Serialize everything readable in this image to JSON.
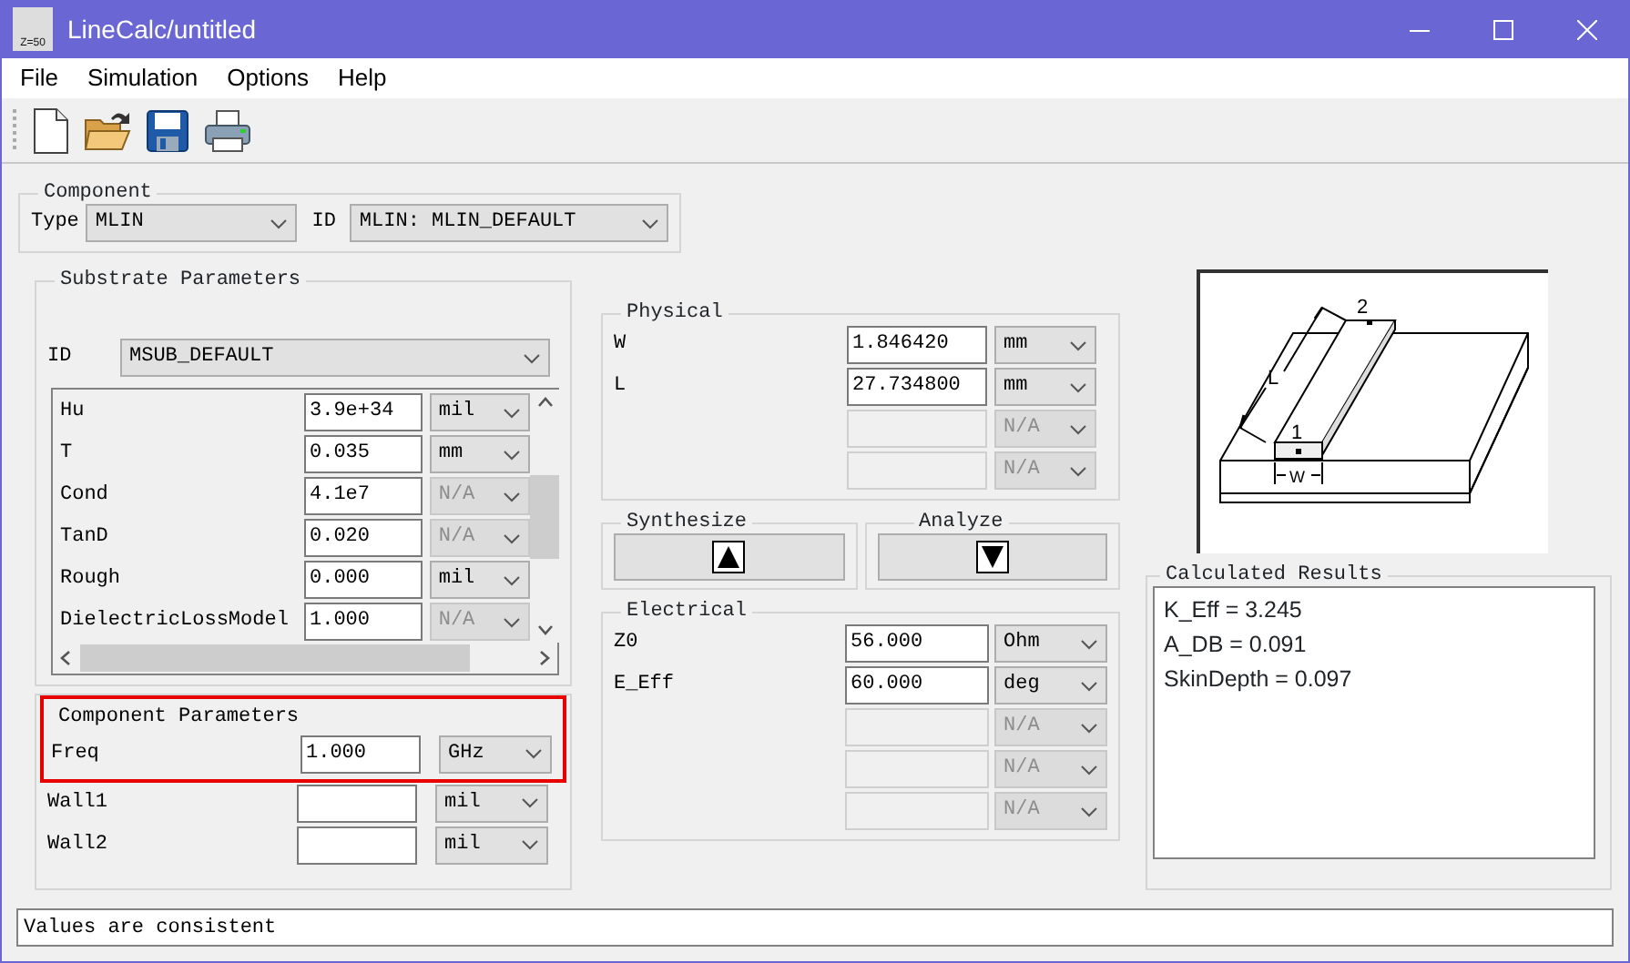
{
  "window": {
    "title": "LineCalc/untitled",
    "icon_label": "Z=50"
  },
  "menu": [
    "File",
    "Simulation",
    "Options",
    "Help"
  ],
  "component": {
    "title": "Component",
    "type_label": "Type",
    "type_value": "MLIN",
    "id_label": "ID",
    "id_value": "MLIN: MLIN_DEFAULT"
  },
  "substrate": {
    "title": "Substrate Parameters",
    "id_label": "ID",
    "id_value": "MSUB_DEFAULT",
    "params": [
      {
        "name": "Hu",
        "value": "3.9e+34",
        "unit": "mil",
        "unit_disabled": false
      },
      {
        "name": "T",
        "value": "0.035",
        "unit": "mm",
        "unit_disabled": false
      },
      {
        "name": "Cond",
        "value": "4.1e7",
        "unit": "N/A",
        "unit_disabled": true
      },
      {
        "name": "TanD",
        "value": "0.020",
        "unit": "N/A",
        "unit_disabled": true
      },
      {
        "name": "Rough",
        "value": "0.000",
        "unit": "mil",
        "unit_disabled": false
      },
      {
        "name": "DielectricLossModel",
        "value": "1.000",
        "unit": "N/A",
        "unit_disabled": true
      }
    ]
  },
  "component_parameters": {
    "title": "Component Parameters",
    "params": [
      {
        "name": "Freq",
        "value": "1.000",
        "unit": "GHz",
        "highlighted": true
      },
      {
        "name": "Wall1",
        "unit": "mil",
        "highlighted": false
      },
      {
        "name": "Wall2",
        "unit": "mil",
        "highlighted": false
      }
    ]
  },
  "physical": {
    "title": "Physical",
    "params": [
      {
        "name": "W",
        "value": "1.846420",
        "unit": "mm",
        "disabled": false
      },
      {
        "name": "L",
        "value": "27.734800",
        "unit": "mm",
        "disabled": false
      },
      {
        "unit": "N/A",
        "disabled": true
      },
      {
        "unit": "N/A",
        "disabled": true
      }
    ]
  },
  "synthesize": {
    "title": "Synthesize"
  },
  "analyze": {
    "title": "Analyze"
  },
  "electrical": {
    "title": "Electrical",
    "params": [
      {
        "name": "Z0",
        "value": "56.000",
        "unit": "Ohm",
        "disabled": false
      },
      {
        "name": "E_Eff",
        "value": "60.000",
        "unit": "deg",
        "disabled": false
      },
      {
        "unit": "N/A",
        "disabled": true
      },
      {
        "unit": "N/A",
        "disabled": true
      },
      {
        "unit": "N/A",
        "disabled": true
      }
    ]
  },
  "diagram": {
    "port_2": "2",
    "length": "L",
    "port_1": "1",
    "width": "W"
  },
  "results": {
    "title": "Calculated Results",
    "lines": [
      "K_Eff = 3.245",
      "A_DB = 0.091",
      "SkinDepth = 0.097"
    ]
  },
  "status_bar": "Values are consistent"
}
